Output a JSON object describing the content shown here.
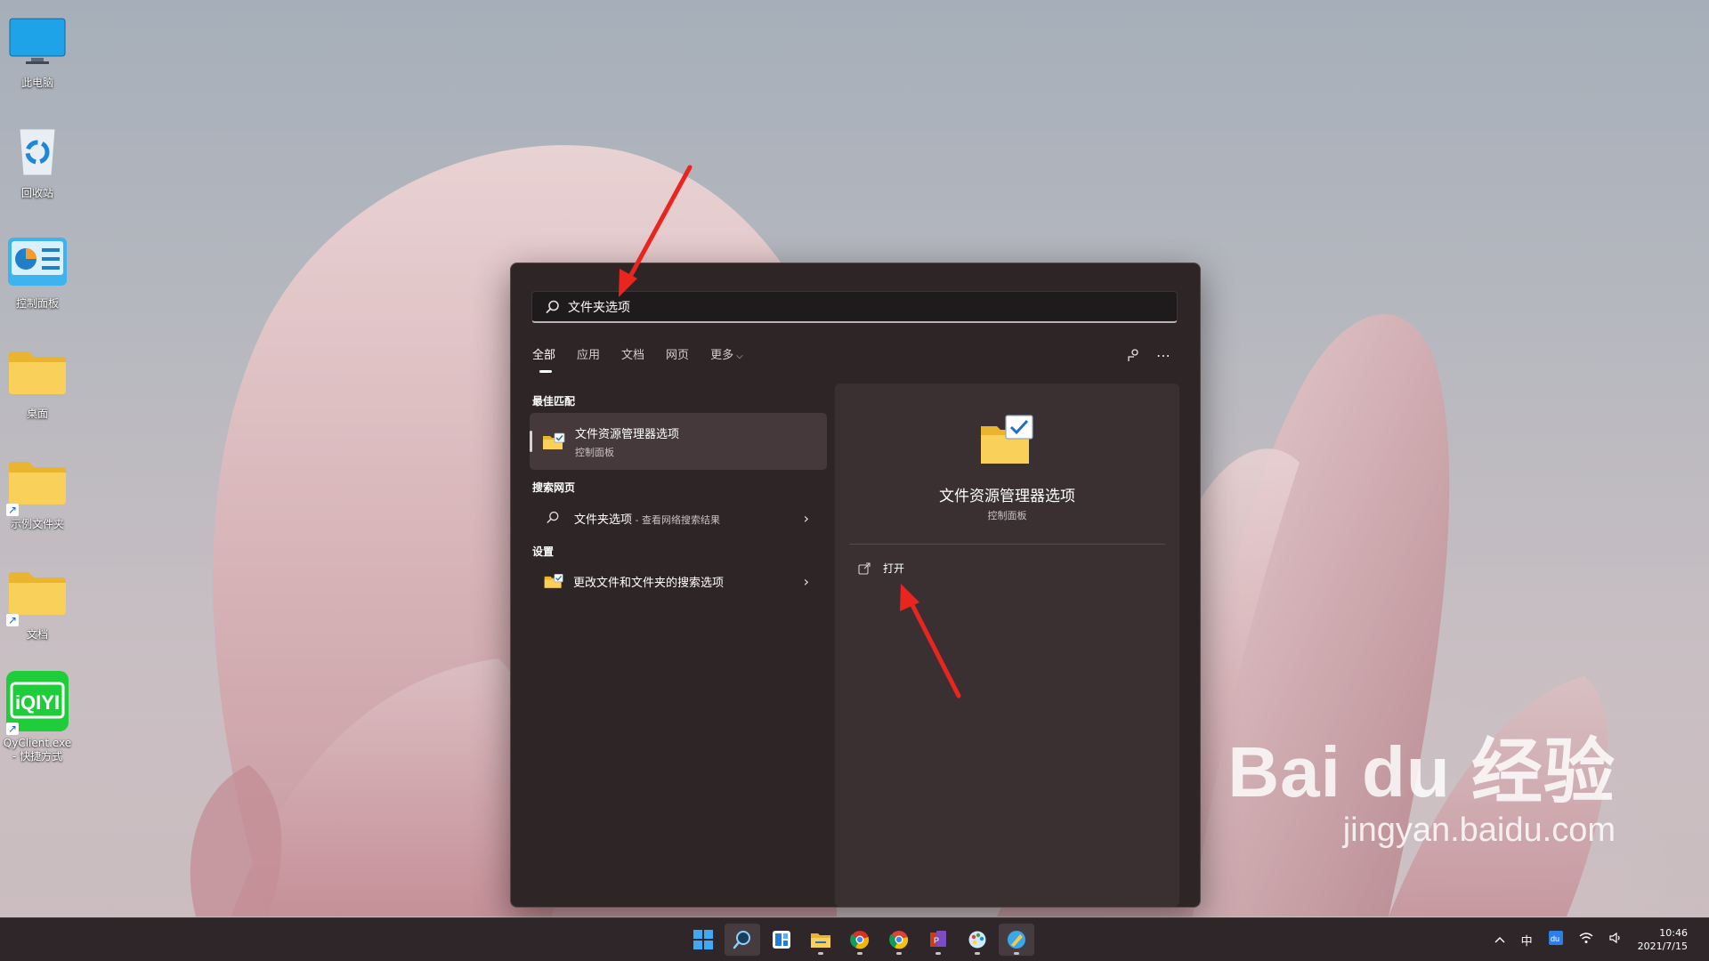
{
  "desktop": {
    "icons": [
      {
        "label": "此电脑"
      },
      {
        "label": "回收站"
      },
      {
        "label": "控制面板"
      },
      {
        "label": "桌面"
      },
      {
        "label": "示例文件夹"
      },
      {
        "label": "文档"
      },
      {
        "label": "QyClient.exe - 快捷方式",
        "logo_text": "iQIYI"
      }
    ]
  },
  "search": {
    "query": "文件夹选项",
    "tabs": [
      {
        "label": "全部",
        "active": true
      },
      {
        "label": "应用"
      },
      {
        "label": "文档"
      },
      {
        "label": "网页"
      },
      {
        "label": "更多"
      }
    ],
    "sections": {
      "best_match": "最佳匹配",
      "web": "搜索网页",
      "settings": "设置"
    },
    "best_match_result": {
      "title": "文件资源管理器选项",
      "subtitle": "控制面板"
    },
    "web_result": {
      "title": "文件夹选项",
      "suffix": " - 查看网络搜索结果"
    },
    "settings_result": {
      "title": "更改文件和文件夹的搜索选项"
    },
    "detail": {
      "title": "文件资源管理器选项",
      "subtitle": "控制面板",
      "action_label": "打开"
    }
  },
  "watermark": {
    "brand": "Bai du 经验",
    "url": "jingyan.baidu.com"
  },
  "taskbar": {
    "apps": [
      "windows-start",
      "search",
      "widgets",
      "file-explorer",
      "chrome-beta",
      "chrome",
      "office",
      "paint",
      "app"
    ],
    "tray": {
      "ime": "中",
      "time": "10:46",
      "date": "2021/7/15"
    }
  },
  "colors": {
    "flyout_bg": "#2e2527",
    "accent_arrow": "#e8251f",
    "folder_yellow": "#f6c945"
  }
}
